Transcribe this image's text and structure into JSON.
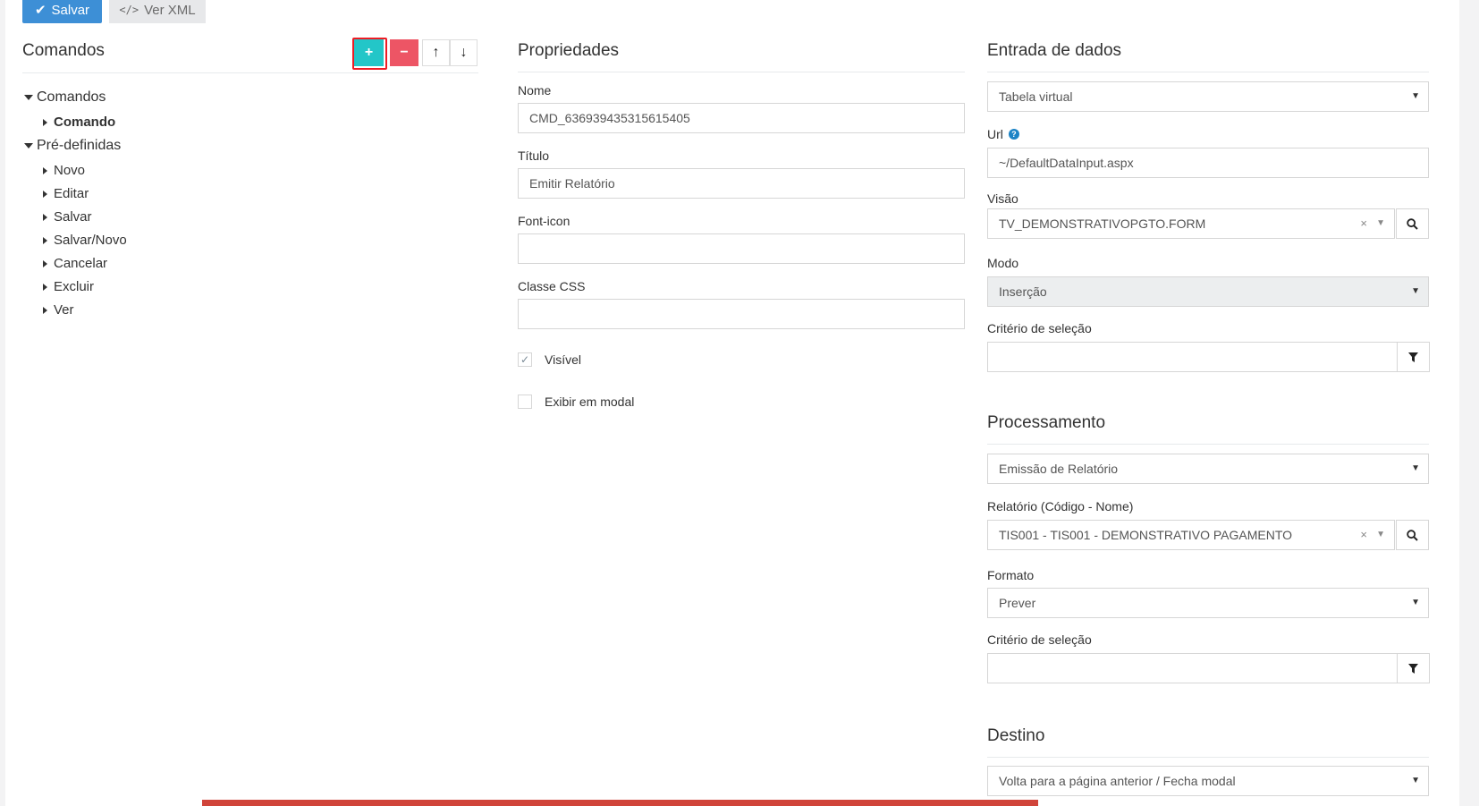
{
  "toolbar": {
    "save_label": "Salvar",
    "xml_label": "Ver XML",
    "xml_icon": "</>"
  },
  "commands": {
    "title": "Comandos",
    "add_label": "+",
    "remove_label": "−",
    "up_label": "↑",
    "down_label": "↓",
    "tree": {
      "root1": "Comandos",
      "root1_child": "Comando",
      "root2": "Pré-definidas",
      "root2_children": [
        "Novo",
        "Editar",
        "Salvar",
        "Salvar/Novo",
        "Cancelar",
        "Excluir",
        "Ver"
      ]
    }
  },
  "properties": {
    "title": "Propriedades",
    "nome_label": "Nome",
    "nome_value": "CMD_636939435315615405",
    "titulo_label": "Título",
    "titulo_value": "Emitir Relatório",
    "fonticon_label": "Font-icon",
    "fonticon_value": "",
    "css_label": "Classe CSS",
    "css_value": "",
    "visivel_label": "Visível",
    "visivel_checked": true,
    "modal_label": "Exibir em modal",
    "modal_checked": false
  },
  "data_input": {
    "title": "Entrada de dados",
    "type_value": "Tabela virtual",
    "url_label": "Url",
    "url_value": "~/DefaultDataInput.aspx",
    "visao_label": "Visão",
    "visao_value": "TV_DEMONSTRATIVOPGTO.FORM",
    "modo_label": "Modo",
    "modo_value": "Inserção",
    "criterio_label": "Critério de seleção",
    "criterio_value": ""
  },
  "processing": {
    "title": "Processamento",
    "type_value": "Emissão de Relatório",
    "relatorio_label": "Relatório (Código - Nome)",
    "relatorio_value": "TIS001 - TIS001 - DEMONSTRATIVO PAGAMENTO",
    "formato_label": "Formato",
    "formato_value": "Prever",
    "criterio_label": "Critério de seleção",
    "criterio_value": ""
  },
  "destination": {
    "title": "Destino",
    "value": "Volta para a página anterior / Fecha modal"
  },
  "colors": {
    "primary": "#3d8fd6",
    "add": "#23c6c8",
    "remove": "#ed5565",
    "highlight": "#ed1c24",
    "bottom_bar": "#d0443a"
  }
}
